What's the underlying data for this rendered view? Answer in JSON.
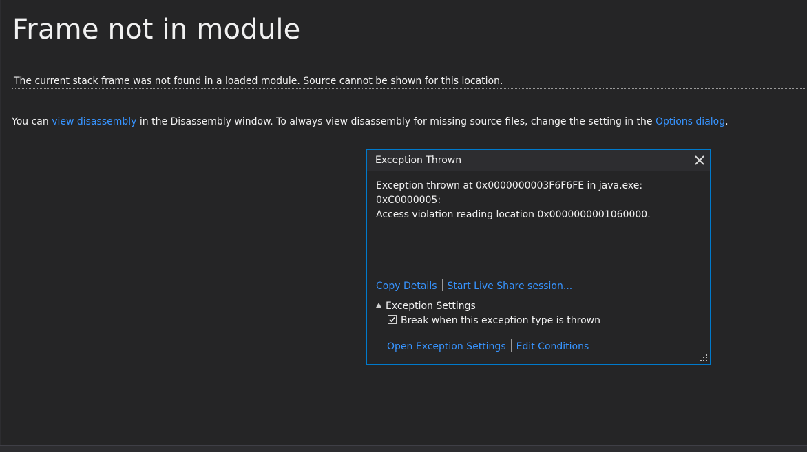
{
  "page": {
    "title": "Frame not in module",
    "frame_message": "The current stack frame was not found in a loaded module. Source cannot be shown for this location.",
    "hint": {
      "prefix": "You can ",
      "view_disassembly_link": "view disassembly",
      "middle": " in the Disassembly window. To always view disassembly for missing source files, change the setting in the ",
      "options_link": "Options dialog",
      "suffix": "."
    }
  },
  "dialog": {
    "title": "Exception Thrown",
    "close_icon": "close-icon",
    "message_line1": "Exception thrown at 0x0000000003F6F6FE in java.exe: 0xC0000005:",
    "message_line2": "Access violation reading location 0x0000000001060000.",
    "copy_details": "Copy Details",
    "live_share": "Start Live Share session...",
    "settings_header": "Exception Settings",
    "break_checkbox_label": "Break when this exception type is thrown",
    "break_checked": true,
    "open_settings": "Open Exception Settings",
    "edit_conditions": "Edit Conditions"
  },
  "colors": {
    "background": "#252526",
    "link": "#3794ff",
    "accent_border": "#007acc",
    "text": "#f1f1f1"
  }
}
